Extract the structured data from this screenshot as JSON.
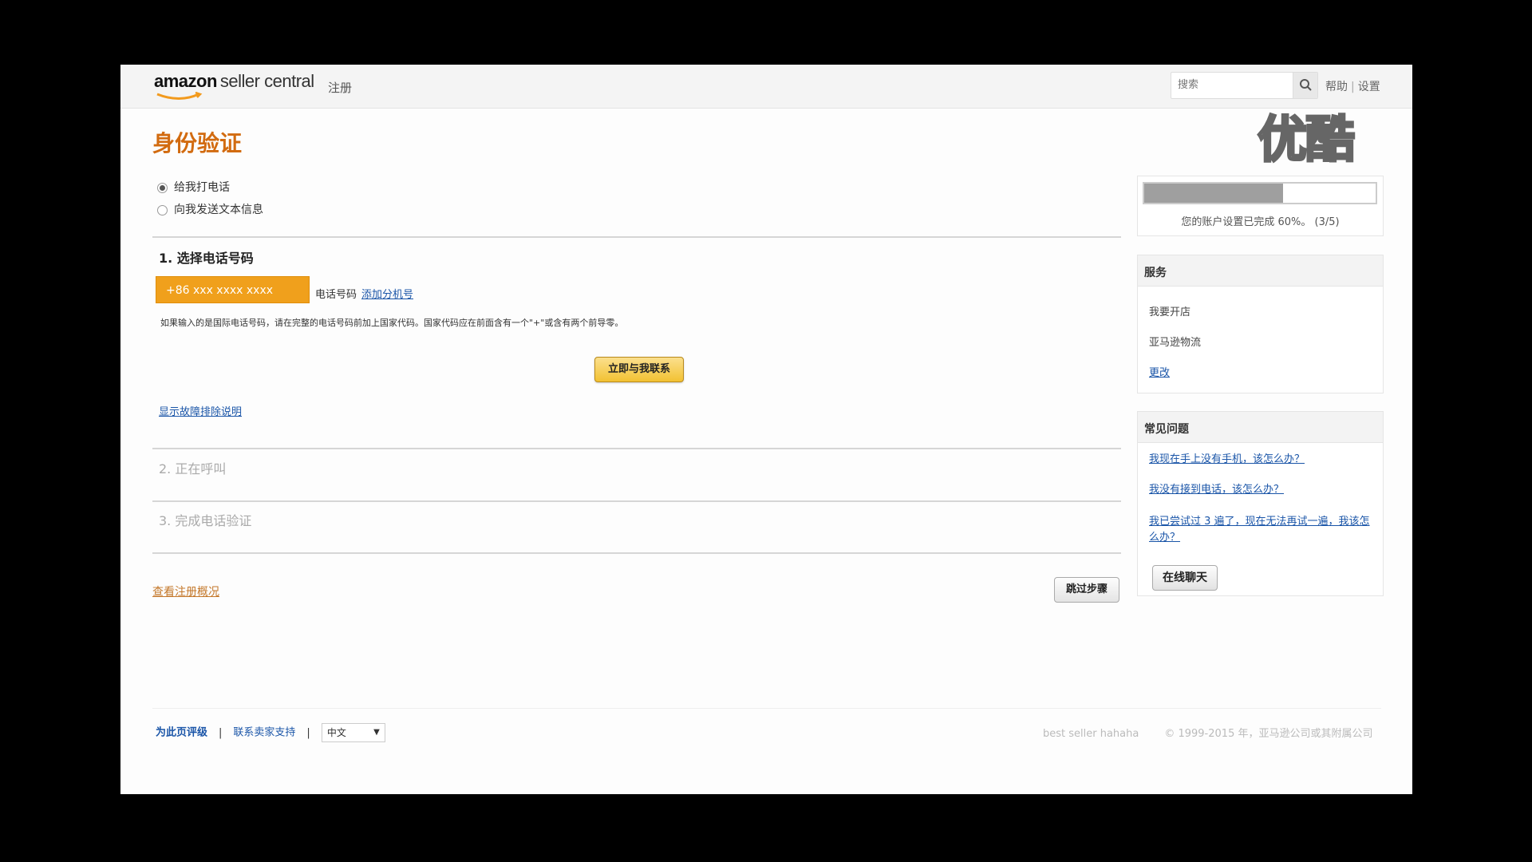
{
  "header": {
    "logo_brand": "amazon",
    "logo_product": "seller central",
    "register_label": "注册",
    "search_placeholder": "搜索",
    "help_label": "帮助",
    "settings_label": "设置"
  },
  "watermark": "优酷",
  "main": {
    "title": "身份验证",
    "options": {
      "call_me": "给我打电话",
      "send_sms": "向我发送文本信息"
    },
    "step1": {
      "title": "1. 选择电话号码",
      "phone_value": "+86 xxx xxxx xxxx",
      "phone_label": "电话号码",
      "add_extension": "添加分机号",
      "hint": "如果输入的是国际电话号码，请在完整的电话号码前加上国家代码。国家代码应在前面含有一个\"+\"或含有两个前导零。",
      "call_now_button": "立即与我联系",
      "troubleshoot_link": "显示故障排除说明"
    },
    "step2_title": "2. 正在呼叫",
    "step3_title": "3. 完成电话验证",
    "view_summary_link": "查看注册概况",
    "skip_button": "跳过步骤"
  },
  "sidebar": {
    "progress": {
      "percent": 60,
      "text": "您的账户设置已完成 60%。 (3/5)"
    },
    "services": {
      "heading": "服务",
      "items": [
        "我要开店",
        "亚马逊物流"
      ],
      "change_link": "更改"
    },
    "faq": {
      "heading": "常见问题",
      "links": [
        "我现在手上没有手机，该怎么办？",
        "我没有接到电话，该怎么办？",
        "我已尝试过 3 遍了，现在无法再试一遍，我该怎么办？"
      ],
      "chat_button": "在线聊天"
    }
  },
  "footer": {
    "feedback": "为此页评级",
    "contact_support": "联系卖家支持",
    "language": "中文",
    "tagline": "best seller hahaha",
    "copyright": "© 1999-2015 年，亚马逊公司或其附属公司"
  }
}
